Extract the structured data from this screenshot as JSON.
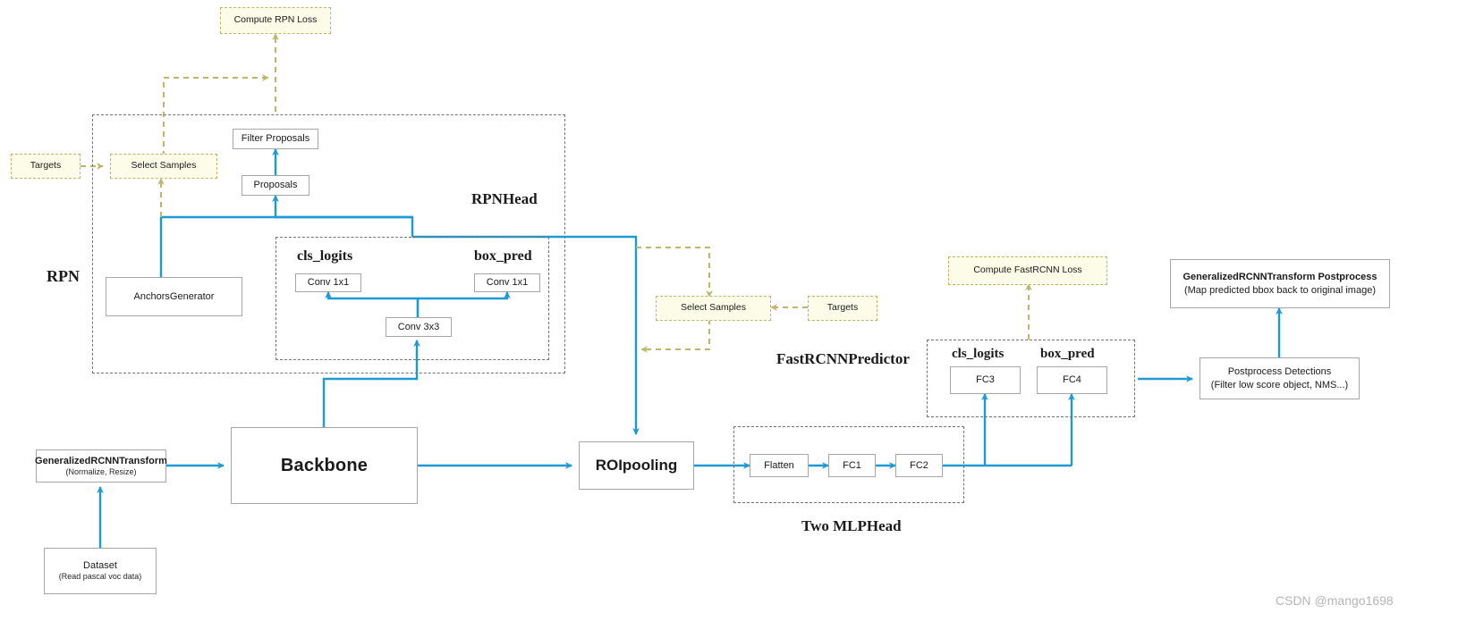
{
  "diagram": {
    "title": "Faster R-CNN architecture flow",
    "colors": {
      "flow_blue": "#1b9ad6",
      "loss_olive": "#bdb76b",
      "yellow_fill": "#fcfce8",
      "box_border": "#a6a6a6",
      "group_border": "#737373",
      "text": "#1a1a1a",
      "watermark": "#b5b5b5"
    },
    "nodes": {
      "compute_rpn_loss": "Compute RPN Loss",
      "targets_rpn": "Targets",
      "select_samples_rpn": "Select Samples",
      "filter_proposals": "Filter Proposals",
      "proposals": "Proposals",
      "anchors_generator": "AnchorsGenerator",
      "conv1x1_cls": "Conv 1x1",
      "conv1x1_box": "Conv 1x1",
      "conv3x3": "Conv 3x3",
      "generalized_transform_title": "GeneralizedRCNNTransform",
      "generalized_transform_sub": "(Normalize, Resize)",
      "dataset_title": "Dataset",
      "dataset_sub": "(Read pascal voc data)",
      "backbone": "Backbone",
      "roipooling": "ROIpooling",
      "flatten": "Flatten",
      "fc1": "FC1",
      "fc2": "FC2",
      "select_samples_frcnn": "Select Samples",
      "targets_frcnn": "Targets",
      "compute_fastrcnn_loss": "Compute FastRCNN Loss",
      "fc3": "FC3",
      "fc4": "FC4",
      "postprocess_detections_title": "Postprocess Detections",
      "postprocess_detections_sub": "(Filter low score object,  NMS...)",
      "transform_postprocess_title": "GeneralizedRCNNTransform    Postprocess",
      "transform_postprocess_sub": "(Map predicted bbox back to original image)"
    },
    "captions": {
      "rpn": "RPN",
      "rpn_head": "RPNHead",
      "cls_logits_rpn": "cls_logits",
      "box_pred_rpn": "box_pred",
      "fastrcnn_predictor": "FastRCNNPredictor",
      "cls_logits_frcnn": "cls_logits",
      "box_pred_frcnn": "box_pred",
      "two_mlp_head": "Two MLPHead"
    },
    "watermark": "CSDN @mango1698"
  }
}
